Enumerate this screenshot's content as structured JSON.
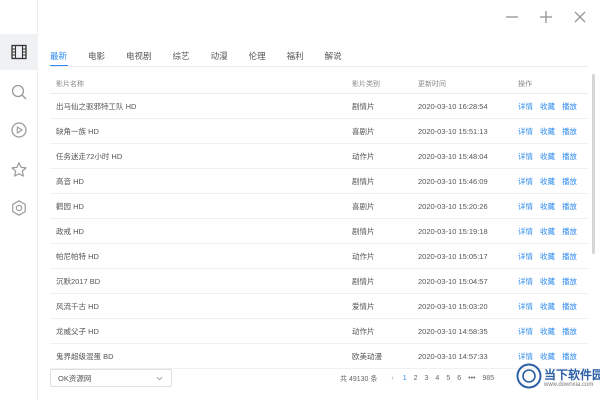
{
  "window": {
    "minimize_icon": "minus-icon",
    "add_icon": "plus-icon",
    "close_icon": "close-icon"
  },
  "sidebar": {
    "items": [
      {
        "icon": "film-icon",
        "active": true
      },
      {
        "icon": "search-icon",
        "active": false
      },
      {
        "icon": "play-icon",
        "active": false
      },
      {
        "icon": "star-icon",
        "active": false
      },
      {
        "icon": "gear-icon",
        "active": false
      }
    ]
  },
  "tabs": [
    "最新",
    "电影",
    "电视剧",
    "综艺",
    "动漫",
    "伦理",
    "福利",
    "解说"
  ],
  "accent_color": "#2f8cf0",
  "table": {
    "columns": [
      "影片名称",
      "影片类别",
      "更新时间",
      "操作"
    ],
    "actions": [
      "详情",
      "收藏",
      "播放"
    ],
    "rows": [
      {
        "name": "出马仙之驱邪特工队 HD",
        "type": "剧情片",
        "time": "2020-03-10 16:28:54"
      },
      {
        "name": "缺角一族 HD",
        "type": "喜剧片",
        "time": "2020-03-10 15:51:13"
      },
      {
        "name": "任务迷走72小时 HD",
        "type": "动作片",
        "time": "2020-03-10 15:48:04"
      },
      {
        "name": "高音 HD",
        "type": "剧情片",
        "time": "2020-03-10 15:46:09"
      },
      {
        "name": "鹳园 HD",
        "type": "喜剧片",
        "time": "2020-03-10 15:20:26"
      },
      {
        "name": "政戒 HD",
        "type": "剧情片",
        "time": "2020-03-10 15:19:18"
      },
      {
        "name": "帕尼帕特 HD",
        "type": "动作片",
        "time": "2020-03-10 15:05:17"
      },
      {
        "name": "沉默2017 BD",
        "type": "剧情片",
        "time": "2020-03-10 15:04:57"
      },
      {
        "name": "风流千古 HD",
        "type": "爱情片",
        "time": "2020-03-10 15:03:20"
      },
      {
        "name": "龙威父子 HD",
        "type": "动作片",
        "time": "2020-03-10 14:58:35"
      },
      {
        "name": "鬼界超级混蛋 BD",
        "type": "欧美动漫",
        "time": "2020-03-10 14:57:33"
      }
    ]
  },
  "footer": {
    "source": "OK资源网",
    "total": "共 49130 条",
    "pages": [
      "1",
      "2",
      "3",
      "4",
      "5",
      "6"
    ],
    "ellipsis": "•••",
    "last_page": "985"
  },
  "watermark": {
    "text": "当下软件园",
    "url": "www.downxia.com"
  }
}
